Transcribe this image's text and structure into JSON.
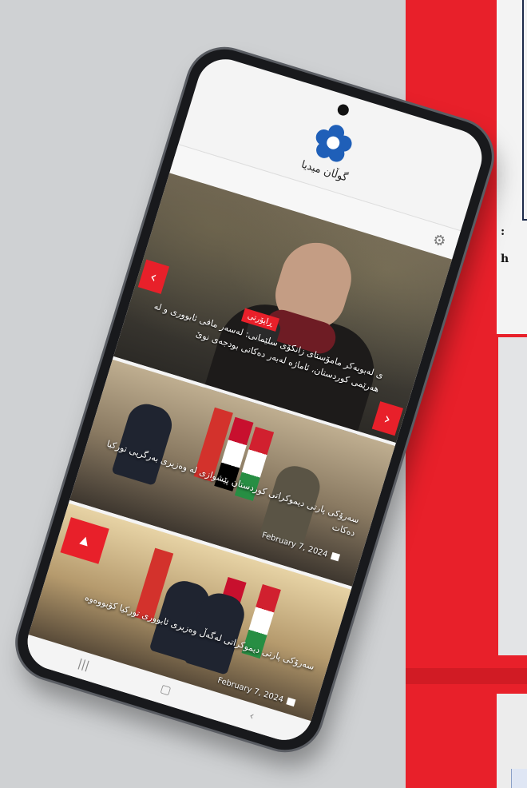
{
  "background": {
    "panel_text_lines": [
      ":",
      "h"
    ],
    "accent_color": "#e8202a"
  },
  "phone": {
    "status_bar": {
      "left": "",
      "right": ""
    },
    "app": {
      "logo_text": "گوڵان میدیا",
      "settings_icon": "gear-icon"
    },
    "hero": {
      "badge": "ڕاپۆرتی",
      "title": "ی لەبوبەکر مامۆستای زانکۆی سلێمانی: لەسەر مافی ئابووری و لە هەرێمی کوردستان، ئاماژە لەبەر دەکاتی بودجەی نوێ",
      "prev_icon": "chevron-left-icon",
      "next_icon": "chevron-right-icon"
    },
    "cards": [
      {
        "title": "سەرۆکی پارتی دیموکراتی کوردستان پێشوازی لە وەزیری بەرگریی تورکیا دەکات",
        "date": "February 7, 2024"
      },
      {
        "title": "سەرۆکی پارتی دیموکراتی لەگەڵ وەزیری ئابووری تورکیا کۆبووەوە",
        "date": "February 7, 2024"
      }
    ],
    "bottom_nav": [
      "menu-icon",
      "home-icon",
      "back-icon"
    ]
  }
}
